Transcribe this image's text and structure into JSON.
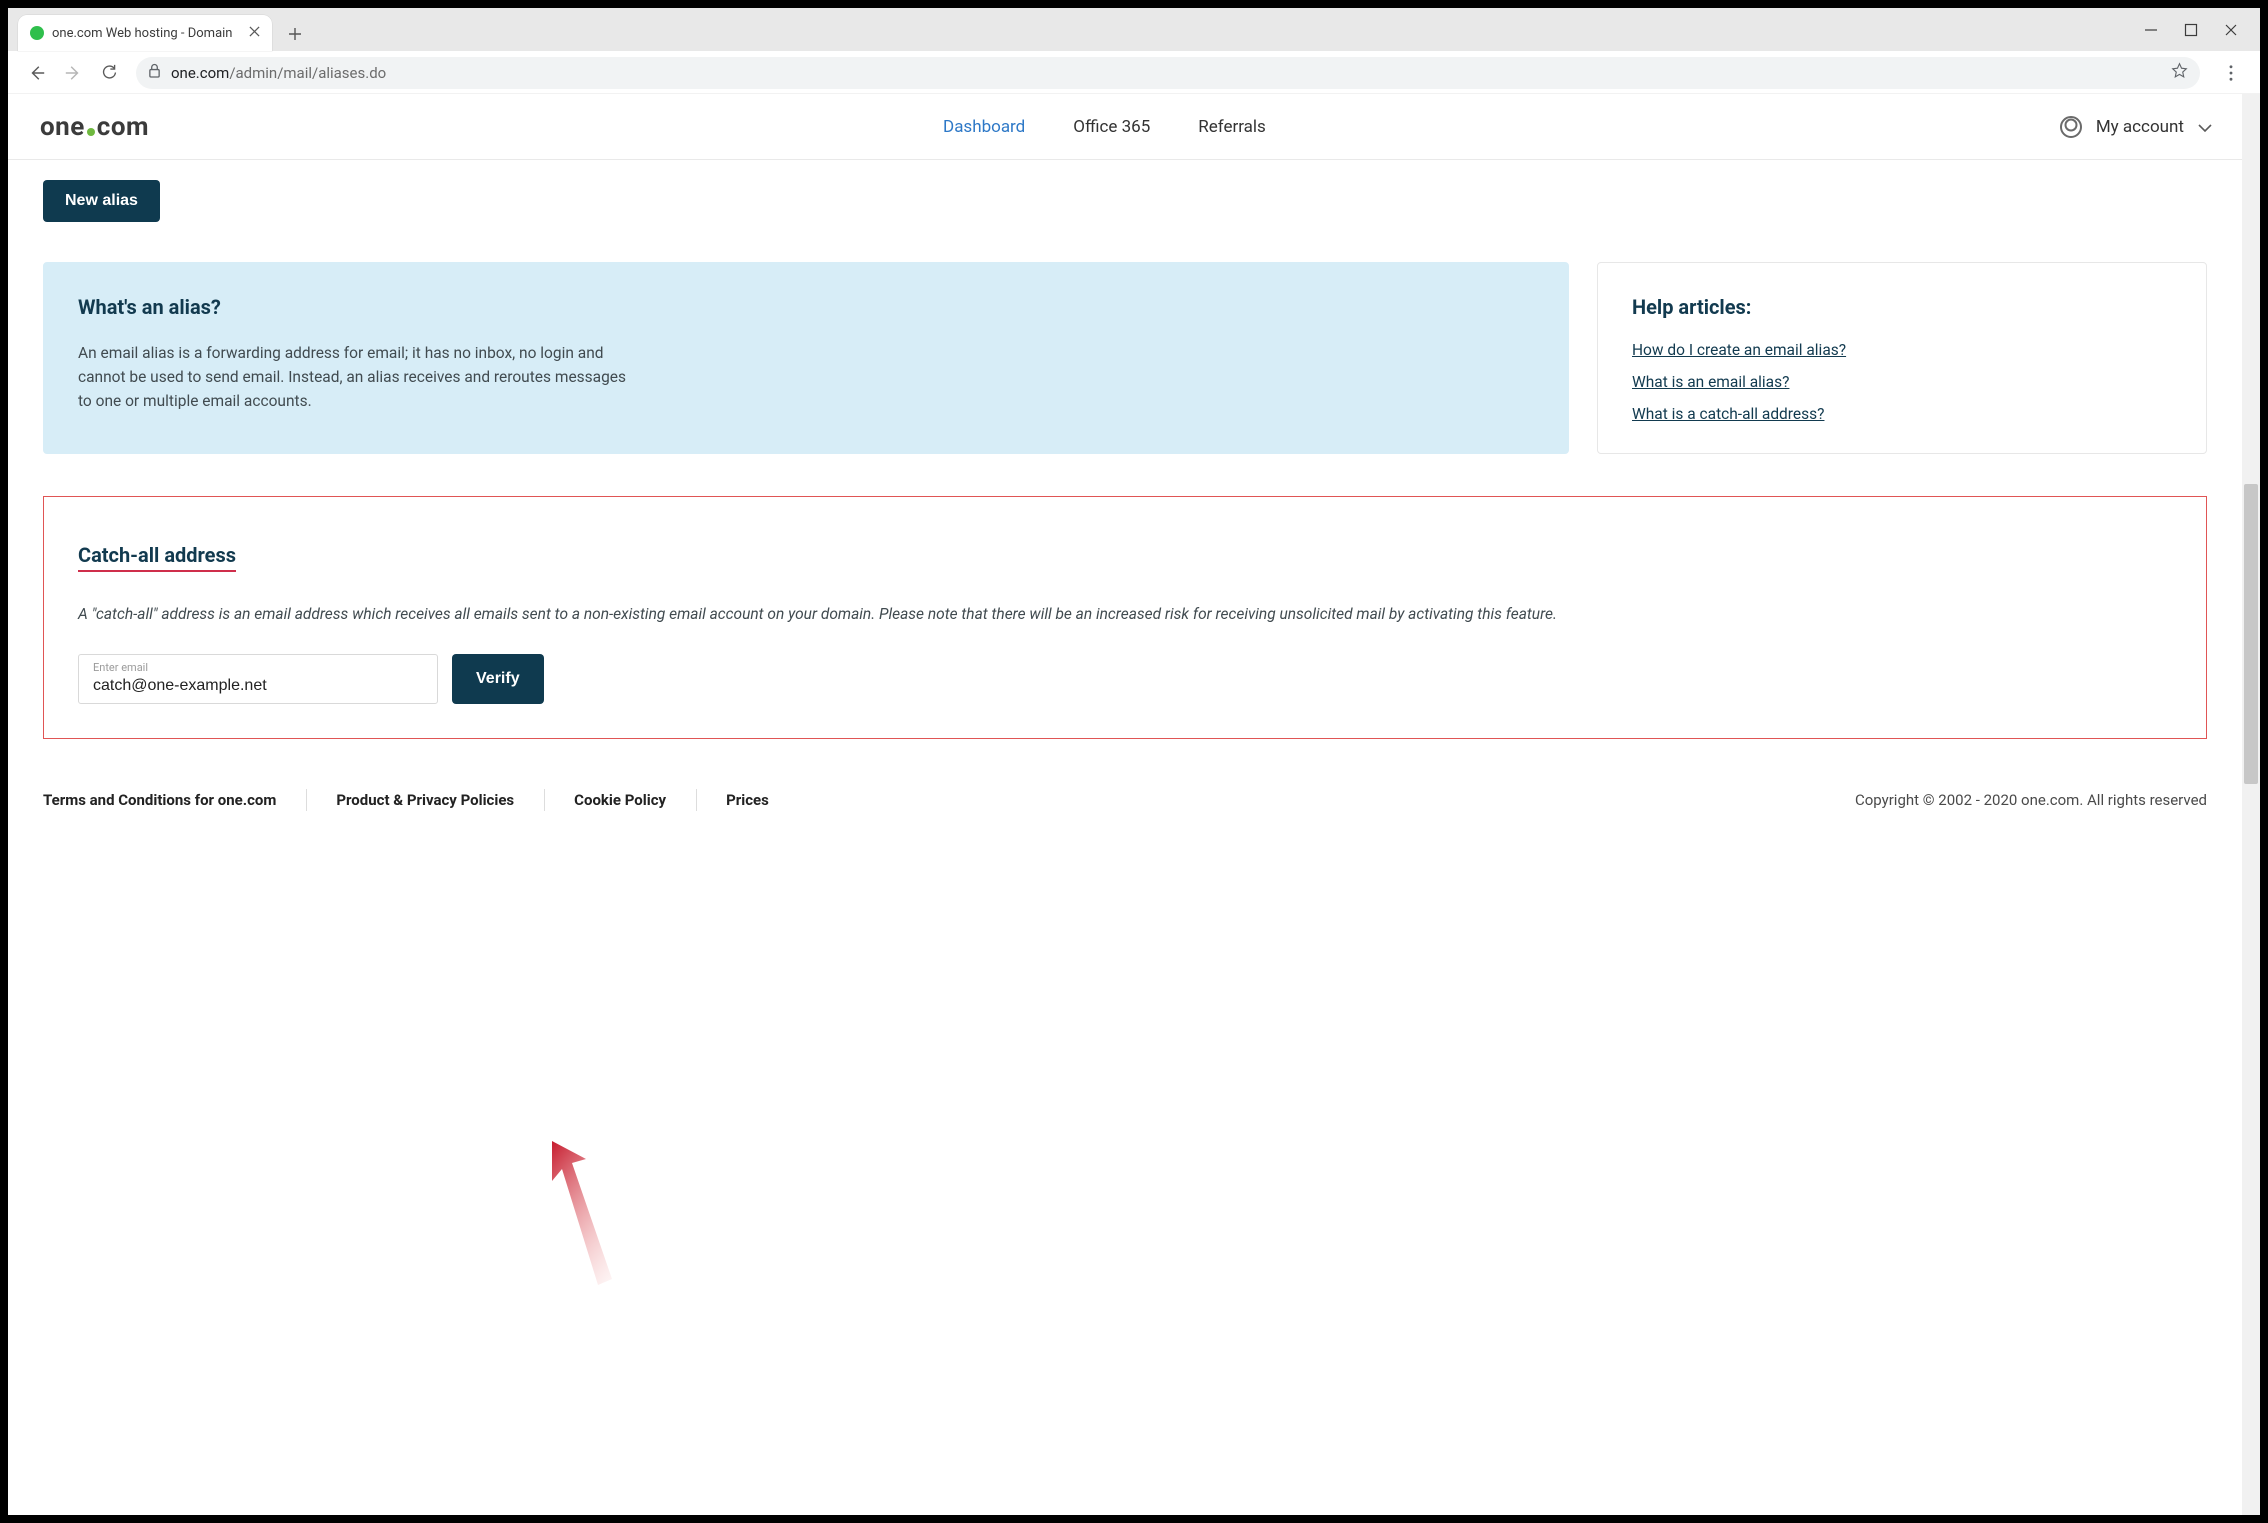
{
  "browser": {
    "tab_title": "one.com Web hosting  -  Domain",
    "url_host": "one.com",
    "url_path": "/admin/mail/aliases.do"
  },
  "header": {
    "logo_left": "one",
    "logo_right": "com",
    "nav": {
      "dashboard": "Dashboard",
      "office365": "Office 365",
      "referrals": "Referrals"
    },
    "account_label": "My account"
  },
  "buttons": {
    "new_alias": "New alias",
    "verify": "Verify"
  },
  "alias_card": {
    "title": "What's an alias?",
    "body": "An email alias is a forwarding address for email; it has no inbox, no login and cannot be used to send email. Instead, an alias receives and reroutes messages to one or multiple email accounts."
  },
  "help_card": {
    "title": "Help articles:",
    "links": {
      "0": "How do I create an email alias?",
      "1": "What is an email alias?",
      "2": "What is a catch-all address?"
    }
  },
  "catchall": {
    "title": "Catch-all address",
    "body": "A \"catch-all\" address is an email address which receives all emails sent to a non-existing email account on your domain. Please note that there will be an increased risk for receiving unsolicited mail by activating this feature.",
    "field_label": "Enter email",
    "field_value": "catch@one-example.net"
  },
  "footer": {
    "links": {
      "0": "Terms and Conditions for one.com",
      "1": "Product & Privacy Policies",
      "2": "Cookie Policy",
      "3": "Prices"
    },
    "copyright": "Copyright © 2002 - 2020 one.com. All rights reserved"
  }
}
